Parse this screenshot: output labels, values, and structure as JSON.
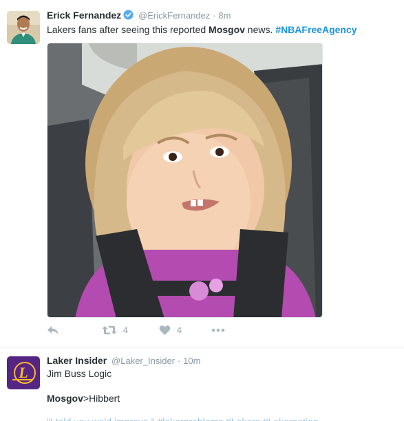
{
  "tweets": [
    {
      "name": "Erick Fernandez",
      "username": "@ErickFernandez",
      "separator": "·",
      "time": "8m",
      "verified": true,
      "text_parts": [
        "Lakers fans after seeing this reported ",
        "Mosgov",
        " news. ",
        "#NBAFreeAgency"
      ],
      "media": "photo of a girl in a car seat with a skeptical expression",
      "retweet_count": "4",
      "like_count": "4"
    },
    {
      "name": "Laker Insider",
      "username": "@Laker_Insider",
      "separator": "·",
      "time": "10m",
      "line1": "Jim Buss Logic",
      "line2_bold": "Mosgov",
      "line2_rest": ">Hibbert",
      "line3": "\"I told you we'd improve \" #lakerproblems #Lakers #Lakernation"
    }
  ],
  "icons": [
    "verified-icon",
    "reply-icon",
    "retweet-icon",
    "like-icon",
    "more-icon"
  ],
  "colors": {
    "link": "#1b95e0",
    "muted": "#8899a6",
    "action": "#aab8c2",
    "verified": "#55acee",
    "lakers_purple": "#552583",
    "lakers_gold": "#fdb927"
  }
}
